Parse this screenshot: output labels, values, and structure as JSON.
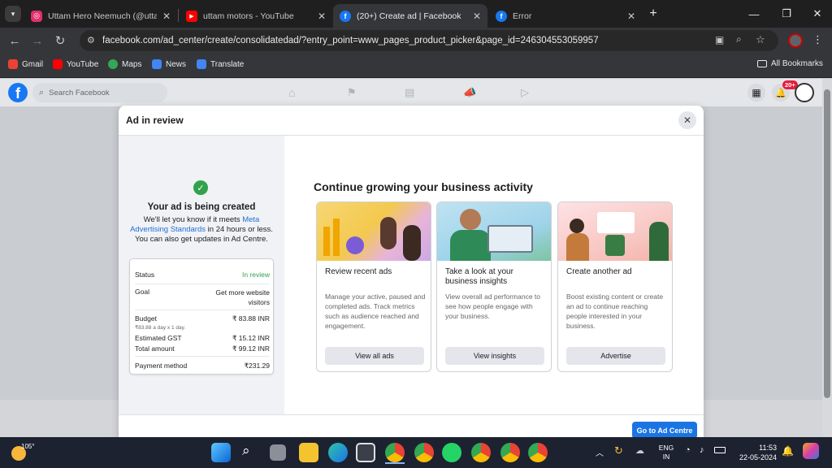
{
  "browser": {
    "tabs": [
      {
        "title": "Uttam Hero Neemuch (@uttam",
        "icon": "instagram-icon",
        "color": "#e1306c",
        "active": false
      },
      {
        "title": "uttam motors - YouTube",
        "icon": "youtube-icon",
        "color": "#ff0000",
        "active": false
      },
      {
        "title": "(20+) Create ad | Facebook",
        "icon": "facebook-icon",
        "color": "#1877f2",
        "active": true
      },
      {
        "title": "Error",
        "icon": "facebook-icon",
        "color": "#1877f2",
        "active": false
      }
    ],
    "url": "facebook.com/ad_center/create/consolidatedad/?entry_point=www_pages_product_picker&page_id=246304553059957",
    "bookmarks": [
      {
        "label": "Gmail",
        "color": "#ea4335"
      },
      {
        "label": "YouTube",
        "color": "#ff0000"
      },
      {
        "label": "Maps",
        "color": "#34a853"
      },
      {
        "label": "News",
        "color": "#4285f4"
      },
      {
        "label": "Translate",
        "color": "#4285f4"
      }
    ],
    "all_bookmarks": "All Bookmarks"
  },
  "facebook": {
    "search_placeholder": "Search Facebook",
    "notification_count": "20+",
    "logo_letter": "f"
  },
  "modal": {
    "title": "Ad in review",
    "left": {
      "heading": "Your ad is being created",
      "text_before": "We'll let you know if it meets ",
      "link": "Meta Advertising Standards",
      "text_after": " in 24 hours or less. You can also get updates in Ad Centre.",
      "summary": {
        "status_label": "Status",
        "status_value": "In review",
        "goal_label": "Goal",
        "goal_value": "Get more website visitors",
        "budget_label": "Budget",
        "budget_value": "₹ 83.88 INR",
        "budget_note": "₹83.88 a day x 1 day.",
        "gst_label": "Estimated GST",
        "gst_value": "₹ 15.12 INR",
        "total_label": "Total amount",
        "total_value": "₹ 99.12 INR",
        "payment_label": "Payment method",
        "payment_value": "₹231.29"
      }
    },
    "right": {
      "heading": "Continue growing your business activity",
      "cards": [
        {
          "title": "Review recent ads",
          "desc": "Manage your active, paused and completed ads. Track metrics such as audience reached and engagement.",
          "button": "View all ads"
        },
        {
          "title": "Take a look at your business insights",
          "desc": "View overall ad performance to see how people engage with your business.",
          "button": "View insights"
        },
        {
          "title": "Create another ad",
          "desc": "Boost existing content or create an ad to continue reaching people interested in your business.",
          "button": "Advertise"
        }
      ]
    },
    "footer_button": "Go to Ad Centre"
  },
  "taskbar": {
    "weather": "105°",
    "lang_1": "ENG",
    "lang_2": "IN",
    "time": "11:53",
    "date": "22-05-2024"
  }
}
